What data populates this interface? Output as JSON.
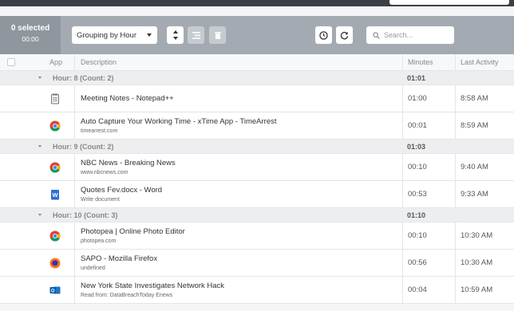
{
  "toolbar": {
    "selected_count": "0 selected",
    "selected_time": "00:00",
    "grouping_label": "Grouping by Hour",
    "search_placeholder": "Search..."
  },
  "columns": {
    "app": "App",
    "description": "Description",
    "minutes": "Minutes",
    "last_activity": "Last Activity"
  },
  "groups": [
    {
      "label": "Hour: 8 (Count: 2)",
      "minutes": "01:01",
      "items": [
        {
          "icon": "notepad-icon",
          "title": "Meeting Notes - Notepad++",
          "sub": "",
          "minutes": "01:00",
          "last": "8:58 AM"
        },
        {
          "icon": "chrome-icon",
          "title": "Auto Capture Your Working Time - xTime App - TimeArrest",
          "sub": "timearrest.com",
          "minutes": "00:01",
          "last": "8:59 AM"
        }
      ]
    },
    {
      "label": "Hour: 9 (Count: 2)",
      "minutes": "01:03",
      "items": [
        {
          "icon": "chrome-icon",
          "title": "NBC News - Breaking News",
          "sub": "www.nbcnews.com",
          "minutes": "00:10",
          "last": "9:40 AM"
        },
        {
          "icon": "word-icon",
          "title": "Quotes Fev.docx - Word",
          "sub": "Write document",
          "minutes": "00:53",
          "last": "9:33 AM"
        }
      ]
    },
    {
      "label": "Hour: 10 (Count: 3)",
      "minutes": "01:10",
      "items": [
        {
          "icon": "chrome-icon",
          "title": "Photopea | Online Photo Editor",
          "sub": "photopea.com",
          "minutes": "00:10",
          "last": "10:30 AM"
        },
        {
          "icon": "firefox-icon",
          "title": "SAPO - Mozilla Firefox",
          "sub": "undefined",
          "minutes": "00:56",
          "last": "10:30 AM"
        },
        {
          "icon": "outlook-icon",
          "title": "New York State Investigates Network Hack",
          "sub": "Read from: DataBreachToday Enews",
          "minutes": "00:04",
          "last": "10:59 AM"
        }
      ]
    }
  ]
}
